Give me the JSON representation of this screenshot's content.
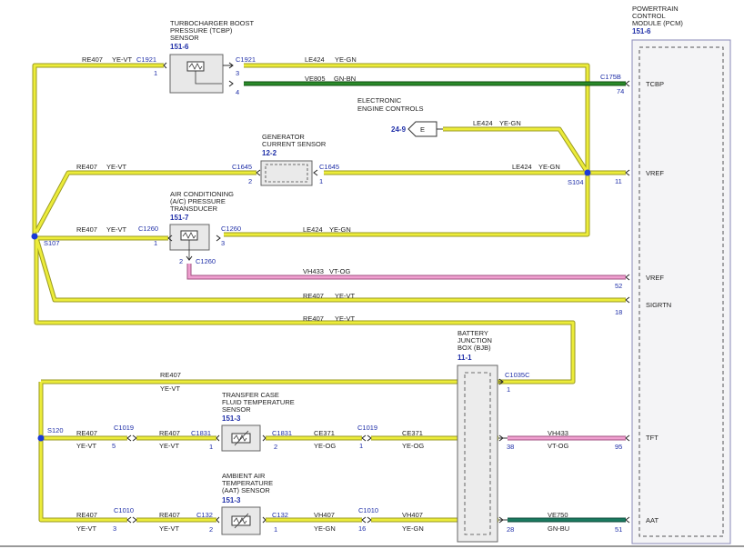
{
  "components": {
    "tcbp": {
      "name": [
        "TURBOCHARGER BOOST",
        "PRESSURE (TCBP)",
        "SENSOR"
      ],
      "ref": "151-6"
    },
    "pcm": {
      "name": [
        "POWERTRAIN",
        "CONTROL",
        "MODULE (PCM)"
      ],
      "ref": "151-6"
    },
    "eec": {
      "name": [
        "ELECTRONIC",
        "ENGINE CONTROLS"
      ],
      "ref": "24-9",
      "tag": "E"
    },
    "gcs": {
      "name": [
        "GENERATOR",
        "CURRENT SENSOR"
      ],
      "ref": "12-2"
    },
    "acp": {
      "name": [
        "AIR CONDITIONING",
        "(A/C) PRESSURE",
        "TRANSDUCER"
      ],
      "ref": "151-7"
    },
    "bjb": {
      "name": [
        "BATTERY",
        "JUNCTION",
        "BOX (BJB)"
      ],
      "ref": "11-1"
    },
    "tcft": {
      "name": [
        "TRANSFER CASE",
        "FLUID TEMPERATURE",
        "SENSOR"
      ],
      "ref": "151-3"
    },
    "aat": {
      "name": [
        "AMBIENT AIR",
        "TEMPERATURE",
        "(AAT) SENSOR"
      ],
      "ref": "151-3"
    }
  },
  "splices": {
    "s104": "S104",
    "s107": "S107",
    "s120": "S120"
  },
  "pcm_pins": [
    {
      "label": "TCBP",
      "pin": "74"
    },
    {
      "label": "VREF",
      "pin": "11"
    },
    {
      "label": "VREF",
      "pin": "52"
    },
    {
      "label": "SIGRTN",
      "pin": "18"
    },
    {
      "label": "TFT",
      "pin": "95"
    },
    {
      "label": "AAT",
      "pin": "51"
    }
  ],
  "connectors": {
    "c1921a": "C1921",
    "c1921b": "C1921",
    "c175b": "C175B",
    "c1645a": "C1645",
    "c1645b": "C1645",
    "c1260a": "C1260",
    "c1260b": "C1260",
    "c1260c": "C1260",
    "c1035c": "C1035C",
    "c1019a": "C1019",
    "c1831a": "C1831",
    "c1831b": "C1831",
    "c1019b": "C1019",
    "c1010a": "C1010",
    "c132a": "C132",
    "c132b": "C132",
    "c1010b": "C1010"
  },
  "pins": {
    "p1921a": "1",
    "p1921b": "3",
    "p1921c": "4",
    "p175b": "74",
    "p1645a": "2",
    "p1645b": "1",
    "p11": "11",
    "p1260a": "1",
    "p1260b": "3",
    "p1260c": "2",
    "p52": "52",
    "p18": "18",
    "p1035c": "1",
    "p1019a": "5",
    "p1831a": "1",
    "p1831b": "2",
    "p1019b": "1",
    "p38": "38",
    "p95": "95",
    "p1010a": "3",
    "p132a": "2",
    "p132b": "1",
    "p1010b": "16",
    "p28": "28",
    "p51": "51"
  },
  "wires": {
    "w_tcbp_left": [
      "RE407",
      "YE-VT"
    ],
    "w_tcbp_le424": [
      "LE424",
      "YE-GN"
    ],
    "w_tcbp_sig": [
      "VE805",
      "GN-BN"
    ],
    "w_eec": [
      "LE424",
      "YE-GN"
    ],
    "w_gcs_left": [
      "RE407",
      "YE-VT"
    ],
    "w_gcs_right": [
      "LE424",
      "YE-GN"
    ],
    "w_acp_left": [
      "RE407",
      "YE-VT"
    ],
    "w_acp_right": [
      "LE424",
      "YE-GN"
    ],
    "w_acp_sig": [
      "VH433",
      "VT-OG"
    ],
    "w_sigrtn": [
      "RE407",
      "YE-VT"
    ],
    "w_long": [
      "RE407",
      "YE-VT"
    ],
    "w_s120_top": [
      "RE407",
      "YE-VT"
    ],
    "w_tft_1": [
      "RE407",
      "YE-VT"
    ],
    "w_tft_2": [
      "RE407",
      "YE-VT"
    ],
    "w_tft_3": [
      "CE371",
      "YE-OG"
    ],
    "w_tft_4": [
      "CE371",
      "YE-OG"
    ],
    "w_tft_5": [
      "VH433",
      "VT-OG"
    ],
    "w_aat_1": [
      "RE407",
      "YE-VT"
    ],
    "w_aat_2": [
      "RE407",
      "YE-VT"
    ],
    "w_aat_3": [
      "VH407",
      "YE-GN"
    ],
    "w_aat_4": [
      "VH407",
      "YE-GN"
    ],
    "w_aat_5": [
      "VE750",
      "GN-BU"
    ]
  },
  "wire_colors": {
    "yellow": "#e8e830",
    "yellow_edge": "#9a9a20",
    "green": "#1d7a1d",
    "pink": "#e88fc0",
    "teal": "#1a7a60",
    "splice": "#1a3ad8"
  }
}
